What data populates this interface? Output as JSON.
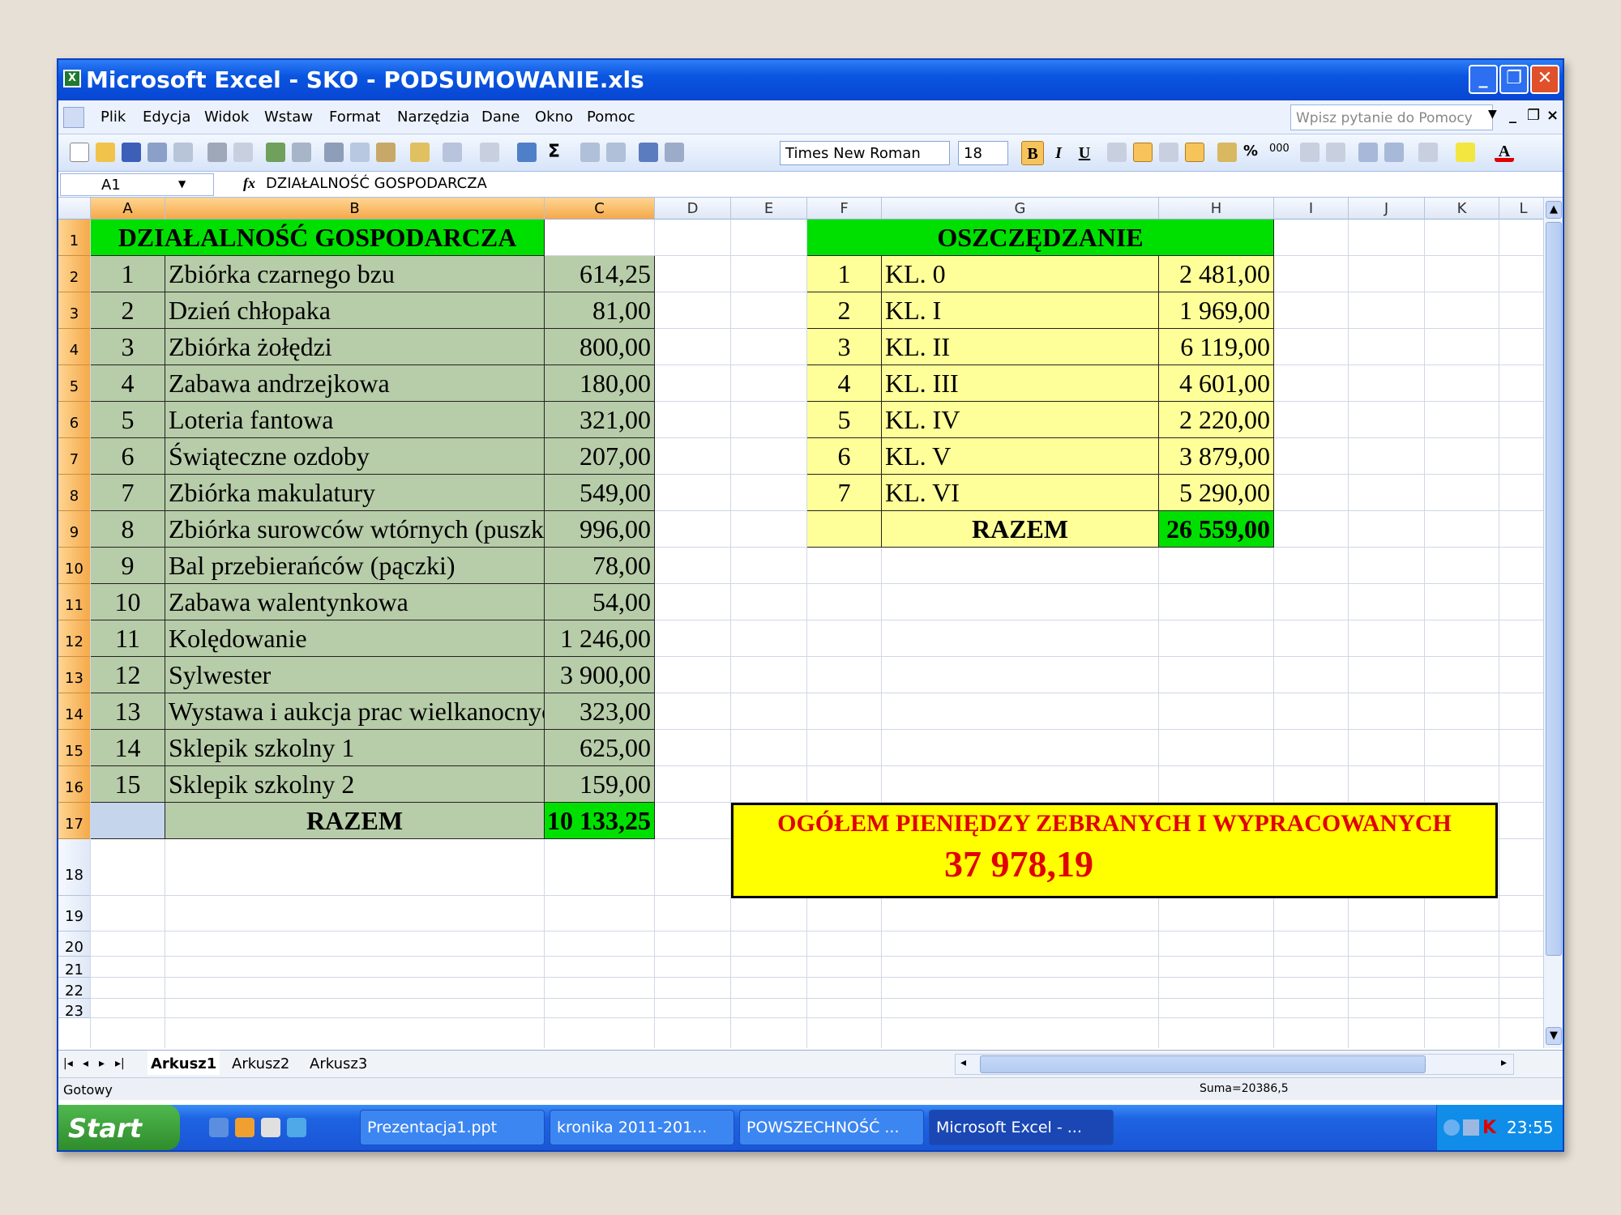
{
  "window": {
    "title": "Microsoft Excel - SKO - PODSUMOWANIE.xls"
  },
  "menu": [
    "Plik",
    "Edycja",
    "Widok",
    "Wstaw",
    "Format",
    "Narzędzia",
    "Dane",
    "Okno",
    "Pomoc"
  ],
  "help_placeholder": "Wpisz pytanie do Pomocy",
  "toolbar": {
    "font": "Times New Roman",
    "size": "18",
    "bold_label": "B",
    "italic_label": "I",
    "underline_label": "U",
    "percent": "%",
    "thousands": "000"
  },
  "formula": {
    "cell": "A1",
    "fx": "fx",
    "content": "DZIAŁALNOŚĆ GOSPODARCZA"
  },
  "columns": [
    "A",
    "B",
    "C",
    "D",
    "E",
    "F",
    "G",
    "H",
    "I",
    "J",
    "K",
    "L"
  ],
  "rows": [
    "1",
    "2",
    "3",
    "4",
    "5",
    "6",
    "7",
    "8",
    "9",
    "10",
    "11",
    "12",
    "13",
    "14",
    "15",
    "16",
    "17",
    "18",
    "19",
    "20",
    "21",
    "22",
    "23"
  ],
  "left_table": {
    "header": "DZIAŁALNOŚĆ GOSPODARCZA",
    "items": [
      {
        "no": "1",
        "name": "Zbiórka czarnego bzu",
        "value": "614,25"
      },
      {
        "no": "2",
        "name": "Dzień chłopaka",
        "value": "81,00"
      },
      {
        "no": "3",
        "name": "Zbiórka żołędzi",
        "value": "800,00"
      },
      {
        "no": "4",
        "name": "Zabawa andrzejkowa",
        "value": "180,00"
      },
      {
        "no": "5",
        "name": "Loteria fantowa",
        "value": "321,00"
      },
      {
        "no": "6",
        "name": "Świąteczne ozdoby",
        "value": "207,00"
      },
      {
        "no": "7",
        "name": "Zbiórka makulatury",
        "value": "549,00"
      },
      {
        "no": "8",
        "name": "Zbiórka surowców wtórnych (puszki)",
        "value": "996,00"
      },
      {
        "no": "9",
        "name": "Bal przebierańców (pączki)",
        "value": "78,00"
      },
      {
        "no": "10",
        "name": "Zabawa walentynkowa",
        "value": "54,00"
      },
      {
        "no": "11",
        "name": "Kolędowanie",
        "value": "1 246,00"
      },
      {
        "no": "12",
        "name": "Sylwester",
        "value": "3 900,00"
      },
      {
        "no": "13",
        "name": "Wystawa i aukcja prac wielkanocnych",
        "value": "323,00"
      },
      {
        "no": "14",
        "name": "Sklepik szkolny 1",
        "value": "625,00"
      },
      {
        "no": "15",
        "name": "Sklepik szkolny 2",
        "value": "159,00"
      }
    ],
    "total_label": "RAZEM",
    "total_value": "10 133,25"
  },
  "right_table": {
    "header": "OSZCZĘDZANIE",
    "items": [
      {
        "no": "1",
        "name": "KL. 0",
        "value": "2 481,00"
      },
      {
        "no": "2",
        "name": "KL. I",
        "value": "1 969,00"
      },
      {
        "no": "3",
        "name": "KL. II",
        "value": "6 119,00"
      },
      {
        "no": "4",
        "name": "KL. III",
        "value": "4 601,00"
      },
      {
        "no": "5",
        "name": "KL. IV",
        "value": "2 220,00"
      },
      {
        "no": "6",
        "name": "KL. V",
        "value": "3 879,00"
      },
      {
        "no": "7",
        "name": "KL. VI",
        "value": "5 290,00"
      }
    ],
    "total_label": "RAZEM",
    "total_value": "26 559,00"
  },
  "summary": {
    "title": "OGÓŁEM PIENIĘDZY ZEBRANYCH I WYPRACOWANYCH",
    "value": "37 978,19"
  },
  "sheets": [
    "Arkusz1",
    "Arkusz2",
    "Arkusz3"
  ],
  "status": {
    "left": "Gotowy",
    "sum": "Suma=20386,5"
  },
  "taskbar": {
    "start": "Start",
    "tasks": [
      "Prezentacja1.ppt",
      "kronika 2011-201...",
      "POWSZECHNOŚĆ ...",
      "Microsoft Excel - ..."
    ],
    "clock": "23:55"
  },
  "colors": {
    "green_fill": "#b7cca8",
    "yellow_fill": "#ffff99",
    "total_fill": "#00e000",
    "summary_fill": "#ffff00",
    "summary_text": "#e00000"
  }
}
